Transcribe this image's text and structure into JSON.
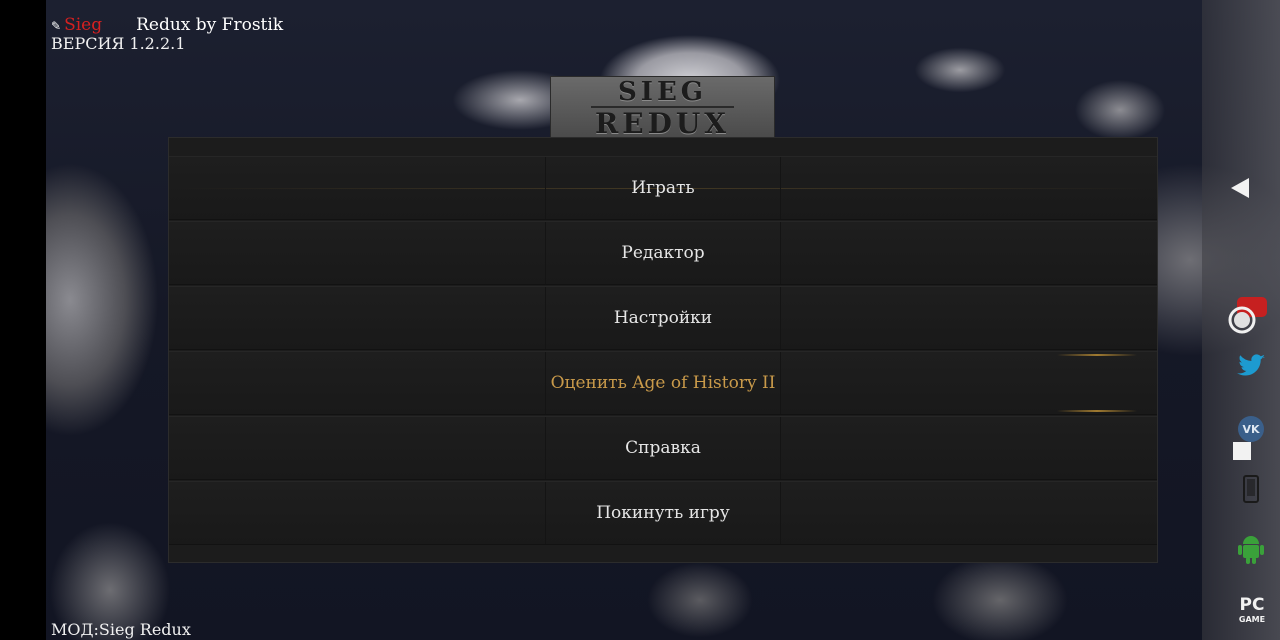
{
  "header": {
    "brand": "Sieg",
    "title_rest": "Redux by Frostik",
    "version": "ВЕРСИЯ 1.2.2.1"
  },
  "logo": {
    "line1": "SIEG",
    "line2": "REDUX"
  },
  "menu": {
    "items": [
      {
        "label": "Играть"
      },
      {
        "label": "Редактор"
      },
      {
        "label": "Настройки"
      },
      {
        "label": "Оценить Age of History II"
      },
      {
        "label": "Справка"
      },
      {
        "label": "Покинуть игру"
      }
    ]
  },
  "footer": {
    "mod_label": "МОД:Sieg Redux"
  },
  "side_panel": {
    "icons": [
      "back-arrow-icon",
      "record-icon",
      "twitter-icon",
      "vk-icon",
      "stop-icon",
      "phone-icon",
      "android-icon",
      "pc-game-icon"
    ],
    "pc_game_text": [
      "PC",
      "GAME"
    ]
  },
  "colors": {
    "highlight": "#c99a4a",
    "brand": "#d42020",
    "menu_bg": "#1c1c1c"
  }
}
